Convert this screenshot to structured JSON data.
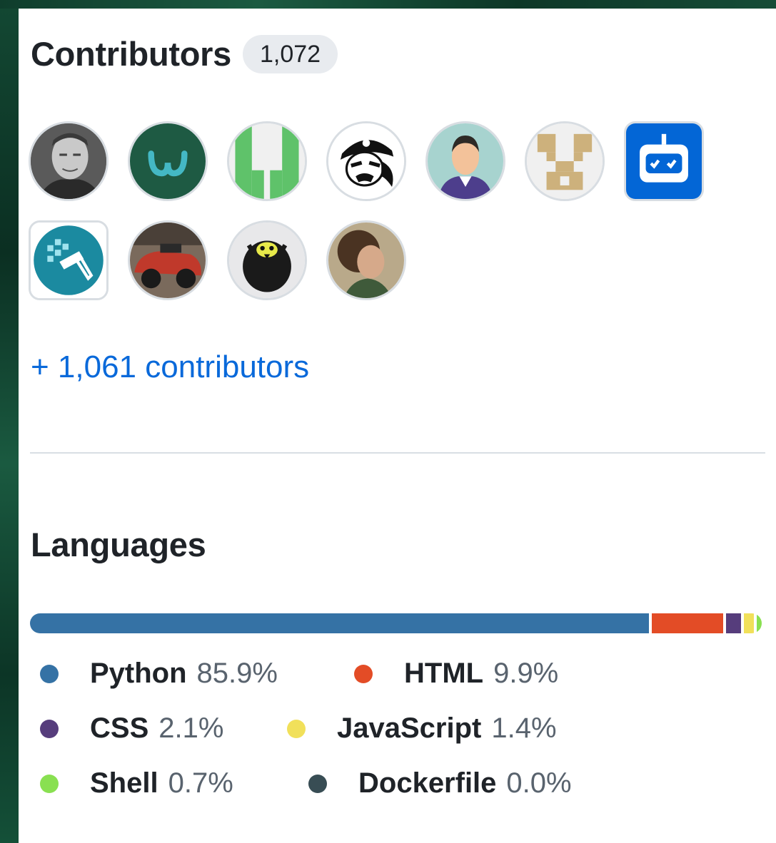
{
  "contributors": {
    "title": "Contributors",
    "count": "1,072",
    "more_link": "+ 1,061 contributors",
    "avatars": [
      {
        "name": "avatar-photo-man"
      },
      {
        "name": "avatar-green-logo"
      },
      {
        "name": "avatar-green-blocks"
      },
      {
        "name": "avatar-pirate"
      },
      {
        "name": "avatar-cartoon-man"
      },
      {
        "name": "avatar-tan-identicon"
      },
      {
        "name": "avatar-robot-bot"
      },
      {
        "name": "avatar-paint-roller"
      },
      {
        "name": "avatar-red-car"
      },
      {
        "name": "avatar-black-bird"
      },
      {
        "name": "avatar-curly-hair"
      }
    ]
  },
  "languages": {
    "title": "Languages",
    "items": [
      {
        "name": "Python",
        "percent": "85.9%",
        "value": 85.9,
        "color": "#3572A5"
      },
      {
        "name": "HTML",
        "percent": "9.9%",
        "value": 9.9,
        "color": "#e34c26"
      },
      {
        "name": "CSS",
        "percent": "2.1%",
        "value": 2.1,
        "color": "#563d7c"
      },
      {
        "name": "JavaScript",
        "percent": "1.4%",
        "value": 1.4,
        "color": "#f1e05a"
      },
      {
        "name": "Shell",
        "percent": "0.7%",
        "value": 0.7,
        "color": "#89e051"
      },
      {
        "name": "Dockerfile",
        "percent": "0.0%",
        "value": 0.0,
        "color": "#384d54"
      }
    ]
  }
}
